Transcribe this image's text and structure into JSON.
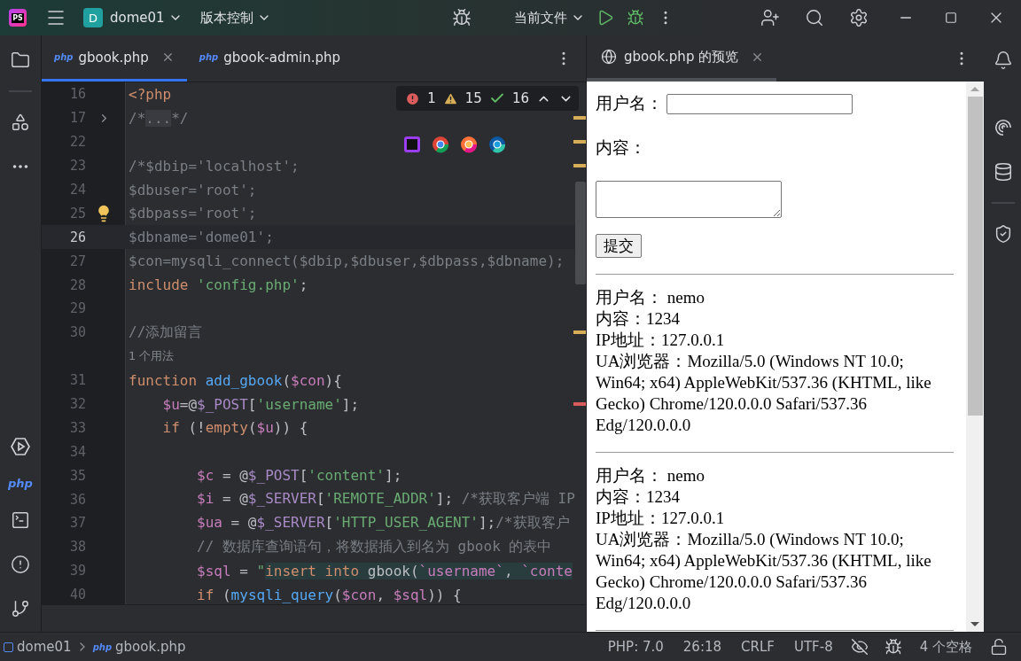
{
  "title_bar": {
    "logo": "PS",
    "project": {
      "badge": "D",
      "name": "dome01"
    },
    "vcs": "版本控制",
    "run_config": "当前文件"
  },
  "left_strip": {
    "php_label": "php"
  },
  "editor_tabs": [
    {
      "label": "gbook.php",
      "icon": "php",
      "selected": true
    },
    {
      "label": "gbook-admin.php",
      "icon": "php",
      "selected": false
    }
  ],
  "inspections": {
    "errors": "1",
    "warnings": "15",
    "typos": "16"
  },
  "code": {
    "lines": [
      {
        "number": "16",
        "tokens": [
          {
            "kind": "kw",
            "text": "<?php"
          }
        ]
      },
      {
        "number": "17",
        "foldable": true,
        "stripe": {
          "color": "#d6ae58"
        },
        "tokens": [
          {
            "kind": "cm",
            "text": "/*"
          },
          {
            "kind": "fold",
            "text": "..."
          },
          {
            "kind": "cm",
            "text": "*/"
          }
        ]
      },
      {
        "number": "22",
        "stripe": {
          "color": "#d6ae58"
        }
      },
      {
        "number": "23",
        "stripe": {
          "color": "#d6ae58"
        },
        "tokens": [
          {
            "kind": "cm",
            "text": "/*$dbip='localhost';"
          }
        ]
      },
      {
        "number": "24",
        "tokens": [
          {
            "kind": "cm",
            "text": "$dbuser='root';"
          }
        ]
      },
      {
        "number": "25",
        "intention_bulb": true,
        "tokens": [
          {
            "kind": "cm",
            "text": "$dbpass='root';"
          }
        ]
      },
      {
        "number": "26",
        "current": true,
        "tokens": [
          {
            "kind": "cm",
            "text": "$dbname='dome01';"
          }
        ]
      },
      {
        "number": "27",
        "tokens": [
          {
            "kind": "cm",
            "text": "$con=mysqli_connect($dbip,$dbuser,$dbpass,$dbname);"
          }
        ]
      },
      {
        "number": "28",
        "tokens": [
          {
            "kind": "kw",
            "text": "include "
          },
          {
            "kind": "str",
            "text": "'config.php'"
          },
          {
            "kind": "pl",
            "text": ";"
          }
        ]
      },
      {
        "number": "29"
      },
      {
        "number": "30",
        "stripe": {
          "color": "#d6ae58"
        },
        "tokens": [
          {
            "kind": "cm",
            "text": "//添加留言"
          }
        ]
      },
      {
        "kind": "hint",
        "text": "1 个用法"
      },
      {
        "number": "31",
        "tokens": [
          {
            "kind": "kw",
            "text": "function "
          },
          {
            "kind": "fn",
            "text": "add_gbook"
          },
          {
            "kind": "pl",
            "text": "("
          },
          {
            "kind": "var",
            "text": "$con"
          },
          {
            "kind": "pl",
            "text": "){"
          }
        ]
      },
      {
        "number": "32",
        "stripe": {
          "color": "#db5c5c"
        },
        "tokens": [
          {
            "kind": "var",
            "text": "    $u"
          },
          {
            "kind": "pl",
            "text": "=@"
          },
          {
            "kind": "sg",
            "text": "$_POST"
          },
          {
            "kind": "pl",
            "text": "["
          },
          {
            "kind": "str",
            "text": "'username'"
          },
          {
            "kind": "pl",
            "text": "];"
          }
        ]
      },
      {
        "number": "33",
        "tokens": [
          {
            "kind": "kw",
            "text": "    if "
          },
          {
            "kind": "pl",
            "text": "(!"
          },
          {
            "kind": "kw",
            "text": "empty"
          },
          {
            "kind": "pl",
            "text": "("
          },
          {
            "kind": "var",
            "text": "$u"
          },
          {
            "kind": "pl",
            "text": ")) {"
          }
        ]
      },
      {
        "number": "34"
      },
      {
        "number": "35",
        "tokens": [
          {
            "kind": "var",
            "text": "        $c"
          },
          {
            "kind": "pl",
            "text": " = @"
          },
          {
            "kind": "sg",
            "text": "$_POST"
          },
          {
            "kind": "pl",
            "text": "["
          },
          {
            "kind": "str",
            "text": "'content'"
          },
          {
            "kind": "pl",
            "text": "];"
          }
        ]
      },
      {
        "number": "36",
        "tokens": [
          {
            "kind": "var",
            "text": "        $i"
          },
          {
            "kind": "pl",
            "text": " = @"
          },
          {
            "kind": "sg",
            "text": "$_SERVER"
          },
          {
            "kind": "pl",
            "text": "["
          },
          {
            "kind": "str",
            "text": "'REMOTE_ADDR'"
          },
          {
            "kind": "pl",
            "text": "]; "
          },
          {
            "kind": "cm",
            "text": "/*获取客户端 IP"
          }
        ]
      },
      {
        "number": "37",
        "tokens": [
          {
            "kind": "var",
            "text": "        $ua"
          },
          {
            "kind": "pl",
            "text": " = @"
          },
          {
            "kind": "sg",
            "text": "$_SERVER"
          },
          {
            "kind": "pl",
            "text": "["
          },
          {
            "kind": "str",
            "text": "'HTTP_USER_AGENT'"
          },
          {
            "kind": "pl",
            "text": "];"
          },
          {
            "kind": "cm",
            "text": "/*获取客户"
          }
        ]
      },
      {
        "number": "38",
        "tokens": [
          {
            "kind": "cm",
            "text": "        // 数据库查询语句，将数据插入到名为 gbook 的表中"
          }
        ]
      },
      {
        "number": "39",
        "tokens": [
          {
            "kind": "var",
            "text": "        $sql"
          },
          {
            "kind": "pl",
            "text": " = "
          },
          {
            "kind": "str",
            "text": "\""
          },
          {
            "kind": "sql",
            "text": "insert into"
          },
          {
            "kind": "sqlpl",
            "text": " gbook("
          },
          {
            "kind": "sqlid",
            "text": "`username`"
          },
          {
            "kind": "sqlpl",
            "text": ", "
          },
          {
            "kind": "sqlid",
            "text": "`conte"
          }
        ]
      },
      {
        "number": "40",
        "tokens": [
          {
            "kind": "kw",
            "text": "        if "
          },
          {
            "kind": "pl",
            "text": "("
          },
          {
            "kind": "fn",
            "text": "mysqli_query"
          },
          {
            "kind": "pl",
            "text": "("
          },
          {
            "kind": "var",
            "text": "$con"
          },
          {
            "kind": "pl",
            "text": ", "
          },
          {
            "kind": "var",
            "text": "$sql"
          },
          {
            "kind": "pl",
            "text": ")) {"
          }
        ]
      }
    ]
  },
  "preview_tab": {
    "label": "gbook.php 的预览"
  },
  "preview": {
    "username_label": "用户名：",
    "content_label": "内容：",
    "submit": "提交",
    "entries": [
      {
        "lines": [
          "用户名：  nemo",
          "内容：1234",
          "IP地址：127.0.0.1",
          "UA浏览器：Mozilla/5.0 (Windows NT 10.0; Win64; x64) AppleWebKit/537.36 (KHTML, like Gecko) Chrome/120.0.0.0 Safari/537.36 Edg/120.0.0.0"
        ]
      },
      {
        "lines": [
          "用户名：  nemo",
          "内容：1234",
          "IP地址：127.0.0.1",
          "UA浏览器：Mozilla/5.0 (Windows NT 10.0; Win64; x64) AppleWebKit/537.36 (KHTML, like Gecko) Chrome/120.0.0.0 Safari/537.36 Edg/120.0.0.0"
        ]
      }
    ]
  },
  "status_bar": {
    "breadcrumb": [
      {
        "kind": "project",
        "label": "dome01"
      },
      {
        "kind": "file",
        "icon": "php",
        "label": "gbook.php"
      }
    ],
    "php_version": "PHP: 7.0",
    "position": "26:18",
    "line_ending": "CRLF",
    "encoding": "UTF-8",
    "indent": "4 个空格"
  }
}
